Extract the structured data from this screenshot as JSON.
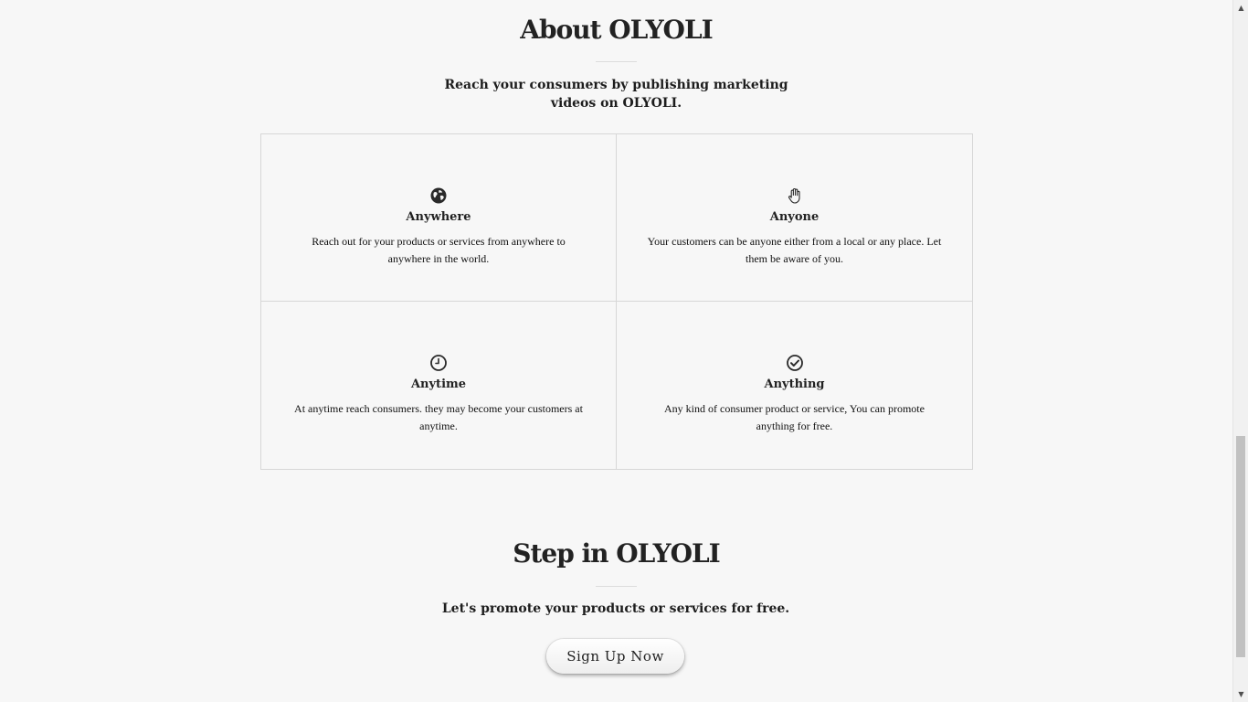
{
  "about": {
    "title": "About OLYOLI",
    "lead": "Reach your consumers by publishing marketing videos on OLYOLI.",
    "features": [
      {
        "icon": "globe-icon",
        "title": "Anywhere",
        "text": "Reach out for your products or services from anywhere to anywhere in the world."
      },
      {
        "icon": "hand-icon",
        "title": "Anyone",
        "text": "Your customers can be anyone either from a local or any place. Let them be aware of you."
      },
      {
        "icon": "clock-icon",
        "title": "Anytime",
        "text": "At anytime reach consumers. they may become your customers at anytime."
      },
      {
        "icon": "check-circle-icon",
        "title": "Anything",
        "text": "Any kind of consumer product or service, You can promote anything for free."
      }
    ]
  },
  "step_in": {
    "title": "Step in OLYOLI",
    "lead": "Let's promote your products or services for free.",
    "button_label": "Sign Up Now"
  },
  "scrollbar": {
    "up_arrow": "▲",
    "down_arrow": "▼"
  },
  "colors": {
    "background": "#f7f7f7",
    "text": "#222222",
    "border": "#d7d7d7"
  }
}
